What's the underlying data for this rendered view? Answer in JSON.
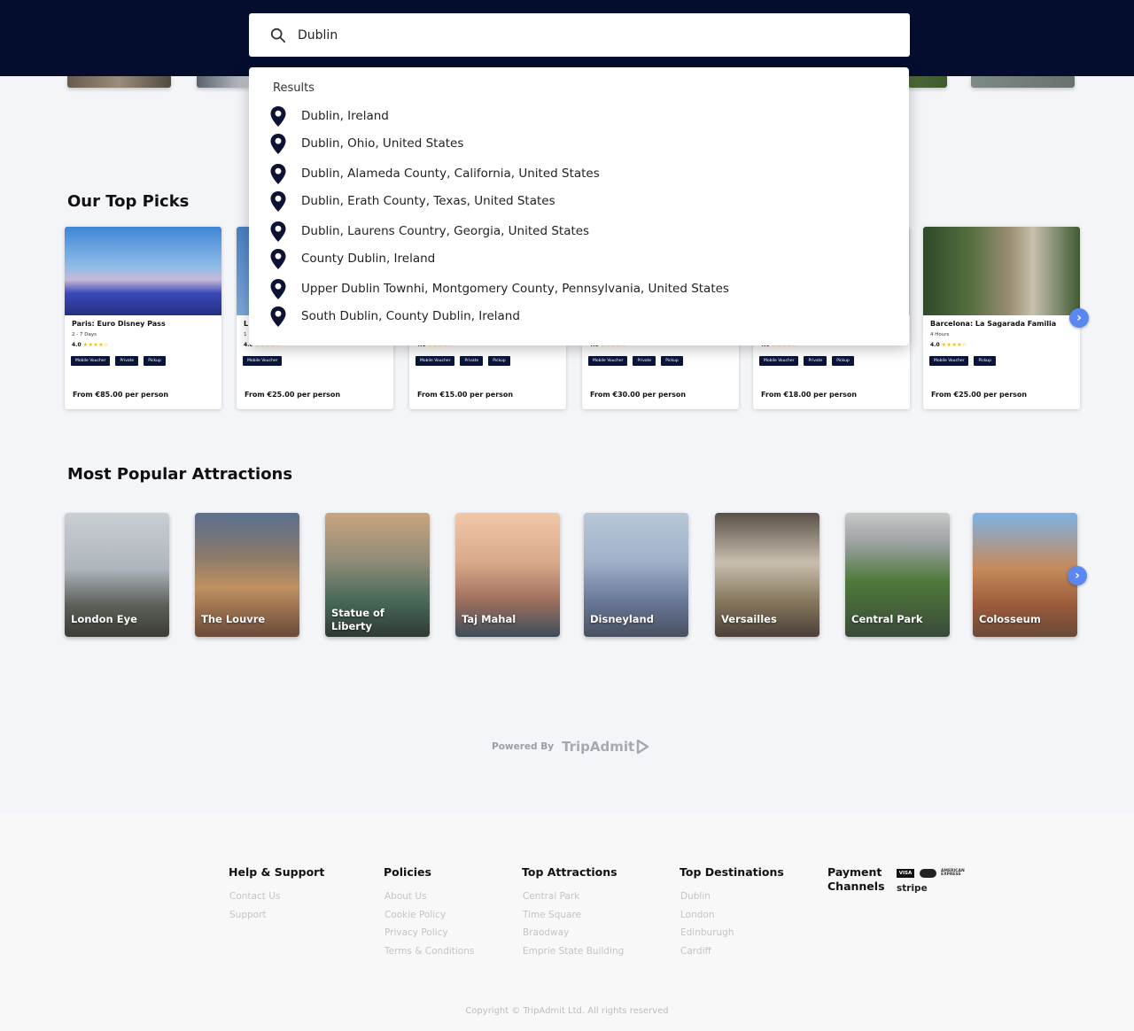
{
  "search": {
    "query": "Dublin"
  },
  "dropdown": {
    "title": "Results",
    "items": [
      "Dublin, Ireland",
      "Dublin, Ohio, United States",
      "Dublin, Alameda County, California, United States",
      "Dublin, Erath County, Texas, United States",
      "Dublin, Laurens Country, Georgia, United States",
      "County Dublin, Ireland",
      "Upper Dublin Townhi, Montgomery County, Pennsylvania, United States",
      "South Dublin, County Dublin, Ireland"
    ]
  },
  "top_picks": {
    "title": "Our Top Picks",
    "cards": [
      {
        "name": "Paris: Euro Disney Pass",
        "duration": "2 - 7 Days",
        "rating": "4.0",
        "stars": "★★★★☆",
        "tags": [
          "Mobile Voucher",
          "Private",
          "Pickup"
        ],
        "price": "From €85.00 per person"
      },
      {
        "name": "L",
        "duration": "1",
        "rating": "4.0",
        "stars": "★★★★☆",
        "tags": [
          "Mobile Voucher"
        ],
        "price": "From €25.00 per person"
      },
      {
        "name": "",
        "duration": "",
        "rating": "4.0",
        "stars": "★★★★☆",
        "tags": [
          "Mobile Voucher",
          "Private",
          "Pickup"
        ],
        "price": "From €15.00 per person"
      },
      {
        "name": "",
        "duration": "",
        "rating": "4.0",
        "stars": "★★★★☆",
        "tags": [
          "Mobile Voucher",
          "Private",
          "Pickup"
        ],
        "price": "From €30.00 per person"
      },
      {
        "name": "",
        "duration": "",
        "rating": "4.0",
        "stars": "★★★★☆",
        "tags": [
          "Mobile Voucher",
          "Private",
          "Pickup"
        ],
        "price": "From €18.00 per person"
      },
      {
        "name": "Barcelona: La Sagarada Familia",
        "duration": "4 Hours",
        "rating": "4.0",
        "stars": "★★★★☆",
        "tags": [
          "Mobile Voucher",
          "Pickup"
        ],
        "price": "From €25.00 per person"
      }
    ]
  },
  "attractions": {
    "title": "Most Popular Attractions",
    "items": [
      "London Eye",
      "The Louvre",
      "Statue of Liberty",
      "Taj Mahal",
      "Disneyland",
      "Versailles",
      "Central Park",
      "Colosseum"
    ]
  },
  "powered": {
    "label": "Powered By",
    "brand": "TripAdmit"
  },
  "footer": {
    "help": {
      "title": "Help & Support",
      "links": [
        "Contact Us",
        "Support"
      ]
    },
    "policies": {
      "title": "Policies",
      "links": [
        "About Us",
        "Cookie Policy",
        "Privacy Policy",
        "Terms & Conditions"
      ]
    },
    "attractions": {
      "title": "Top Attractions",
      "links": [
        "Central Park",
        "Time Square",
        "Braodway",
        "Emprie State Building"
      ]
    },
    "destinations": {
      "title": "Top Destinations",
      "links": [
        "Dublin",
        "London",
        "Edinburugh",
        "Cardiff"
      ]
    },
    "payment": {
      "title_line1": "Payment",
      "title_line2": "Channels",
      "visa": "VISA",
      "amex_line1": "AMERICAN",
      "amex_line2": "EXPRESS",
      "stripe": "stripe"
    },
    "copyright": "Copyright © TripAdmit Ltd. All rights reserved"
  },
  "colors": {
    "header": "#050d2e",
    "accent": "#5b87f2",
    "tag": "#0b1538",
    "star": "#f2b600"
  },
  "icons": {
    "search": "search-icon",
    "location": "location-pin-icon",
    "next": "chevron-right-icon"
  }
}
